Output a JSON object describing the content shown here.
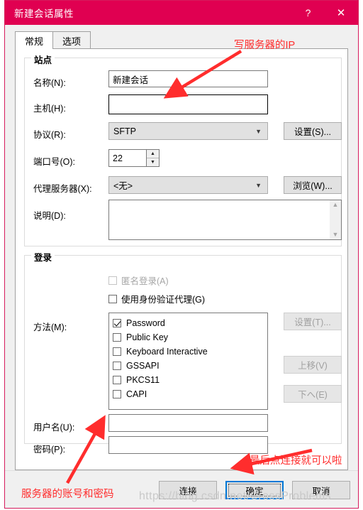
{
  "window": {
    "title": "新建会话属性",
    "help_label": "?",
    "close_label": "✕",
    "accent_color": "#e00051",
    "border_color": "#d61a5c"
  },
  "tabs": [
    {
      "label": "常规",
      "active": true
    },
    {
      "label": "选项",
      "active": false
    }
  ],
  "site_group": {
    "legend": "站点",
    "name_label": "名称(N):",
    "name_value": "新建会话",
    "host_label": "主机(H):",
    "host_value": "",
    "protocol_label": "协议(R):",
    "protocol_value": "SFTP",
    "protocol_button": "设置(S)...",
    "port_label": "端口号(O):",
    "port_value": "22",
    "proxy_label": "代理服务器(X):",
    "proxy_value": "<无>",
    "proxy_button": "浏览(W)...",
    "desc_label": "说明(D):",
    "desc_value": ""
  },
  "login_group": {
    "legend": "登录",
    "anonymous_label": "匿名登录(A)",
    "anonymous_checked": false,
    "anonymous_disabled": true,
    "agent_label": "使用身份验证代理(G)",
    "agent_checked": false,
    "method_label": "方法(M):",
    "methods": [
      {
        "label": "Password",
        "checked": true
      },
      {
        "label": "Public Key",
        "checked": false
      },
      {
        "label": "Keyboard Interactive",
        "checked": false
      },
      {
        "label": "GSSAPI",
        "checked": false
      },
      {
        "label": "PKCS11",
        "checked": false
      },
      {
        "label": "CAPI",
        "checked": false
      }
    ],
    "settings_button": "设置(T)...",
    "moveup_button": "上移(V)",
    "movedown_button": "下へ(E)",
    "username_label": "用户名(U):",
    "username_value": "",
    "password_label": "密码(P):",
    "password_value": ""
  },
  "footer": {
    "connect_button": "连接",
    "ok_button": "确定",
    "cancel_button": "取消"
  },
  "annotations": {
    "top": "写服务器的IP",
    "bottom_right": "最后点连接就可以啦",
    "bottom_left": "服务器的账号和密码",
    "color": "#ff2d2d"
  },
  "watermark": {
    "text": "https://blog.csdn.net/CrossProblems"
  }
}
